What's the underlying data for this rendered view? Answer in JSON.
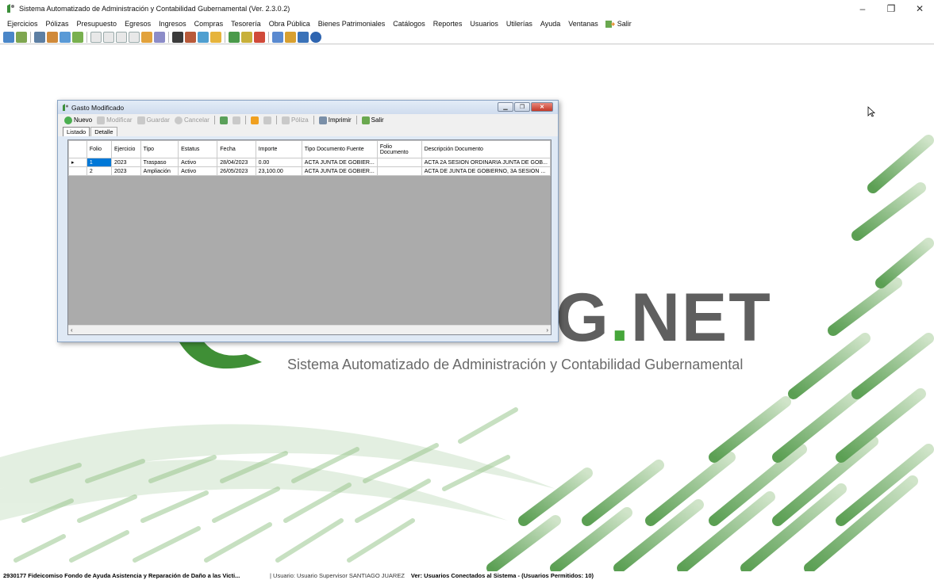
{
  "app": {
    "title": "Sistema Automatizado de Administración y Contabilidad Gubernamental  (Ver. 2.3.0.2)",
    "controls": {
      "minimize": "–",
      "restore": "❐",
      "close": "✕"
    }
  },
  "menu": {
    "items": [
      "Ejercicios",
      "Pólizas",
      "Presupuesto",
      "Egresos",
      "Ingresos",
      "Compras",
      "Tesorería",
      "Obra Pública",
      "Bienes Patrimoniales",
      "Catálogos",
      "Reportes",
      "Usuarios",
      "Utilerías",
      "Ayuda",
      "Ventanas"
    ],
    "salir_label": "Salir"
  },
  "toolbar": {
    "icons": [
      "refresh-icon",
      "chart-icon",
      "truck-icon",
      "scale-icon",
      "list-icon",
      "table-icon",
      "doc1-icon",
      "doc2-icon",
      "doc3-icon",
      "doc4-icon",
      "box-icon",
      "disk-icon",
      "notebook-icon",
      "car-icon",
      "pie-icon",
      "globe-icon",
      "book-icon",
      "pen-icon",
      "shield-icon",
      "tree-icon",
      "bell-icon",
      "chart2-icon",
      "help-icon"
    ]
  },
  "background": {
    "logo_text_main": "G",
    "logo_text_dot": ".",
    "logo_text_tail": "NET",
    "subtitle": "Sistema Automatizado de Administración y Contabilidad Gubernamental"
  },
  "child": {
    "title": "Gasto Modificado",
    "toolbar": {
      "nuevo": "Nuevo",
      "modificar": "Modificar",
      "guardar": "Guardar",
      "cancelar": "Cancelar",
      "poliza": "Póliza",
      "imprimir": "Imprimir",
      "salir": "Salir"
    },
    "tabs": [
      "Listado",
      "Detalle"
    ],
    "columns": [
      "Folio",
      "Ejercicio",
      "Tipo",
      "Estatus",
      "Fecha",
      "Importe",
      "Tipo Documento Fuente",
      "Folio Documento",
      "Descripción Documento"
    ],
    "rows": [
      [
        "1",
        "2023",
        "Traspaso",
        "Activo",
        "28/04/2023",
        "0.00",
        "ACTA JUNTA DE GOBIER...",
        "",
        "ACTA 2A SESION ORDINARIA JUNTA DE GOB..."
      ],
      [
        "2",
        "2023",
        "Ampliación",
        "Activo",
        "26/05/2023",
        "23,100.00",
        "ACTA JUNTA DE GOBIER...",
        "",
        "ACTA DE JUNTA DE GOBIERNO, 3A SESION ..."
      ]
    ],
    "row_indicator": "▸"
  },
  "status": {
    "entity": "2930177 Fideicomiso Fondo de Ayuda Asistencia y Reparación de Daño a las Victi...",
    "user": "| Usuario: Usuario Supervisor SANTIAGO JUAREZ",
    "connected": "Ver: Usuarios Conectados al Sistema - (Usuarios Permitidos: 10)"
  }
}
